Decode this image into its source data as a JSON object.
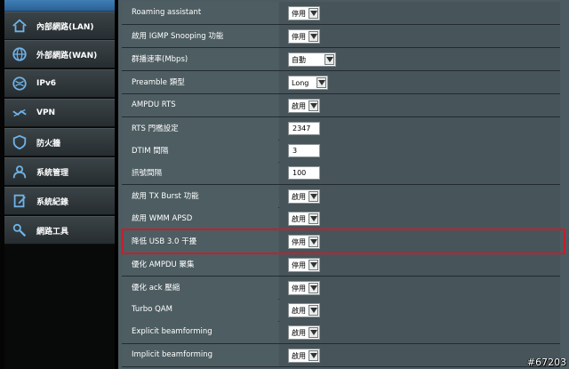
{
  "sidebar": {
    "items": [
      {
        "label": "內部網路(LAN)",
        "icon": "home-icon"
      },
      {
        "label": "外部網路(WAN)",
        "icon": "globe-icon"
      },
      {
        "label": "IPv6",
        "icon": "globe-ipv6-icon"
      },
      {
        "label": "VPN",
        "icon": "vpn-icon"
      },
      {
        "label": "防火牆",
        "icon": "shield-icon"
      },
      {
        "label": "系統管理",
        "icon": "user-icon"
      },
      {
        "label": "系統紀錄",
        "icon": "log-icon"
      },
      {
        "label": "網路工具",
        "icon": "tools-icon"
      }
    ]
  },
  "settings": {
    "rows": [
      {
        "label": "Roaming assistant",
        "control": "select",
        "value": "停用"
      },
      {
        "label": "啟用 IGMP Snooping 功能",
        "control": "select",
        "value": "停用"
      },
      {
        "label": "群播速率(Mbps)",
        "control": "select",
        "value": "自動"
      },
      {
        "label": "Preamble 類型",
        "control": "select",
        "value": "Long"
      },
      {
        "label": "AMPDU RTS",
        "control": "select",
        "value": "啟用"
      },
      {
        "label": "RTS 門檻設定",
        "control": "input",
        "value": "2347"
      },
      {
        "label": "DTIM 間隔",
        "control": "input",
        "value": "3"
      },
      {
        "label": "訊號間隔",
        "control": "input",
        "value": "100"
      },
      {
        "label": "啟用 TX Burst 功能",
        "control": "select",
        "value": "啟用"
      },
      {
        "label": "啟用 WMM APSD",
        "control": "select",
        "value": "啟用"
      },
      {
        "label": "降低 USB 3.0 干擾",
        "control": "select",
        "value": "停用"
      },
      {
        "label": "優化 AMPDU 聚集",
        "control": "select",
        "value": "停用"
      },
      {
        "label": "優化 ack 壓縮",
        "control": "select",
        "value": "停用"
      },
      {
        "label": "Turbo QAM",
        "control": "select",
        "value": "啟用"
      },
      {
        "label": "Explicit beamforming",
        "control": "select",
        "value": "啟用"
      },
      {
        "label": "Implicit beamforming",
        "control": "select",
        "value": "啟用"
      }
    ]
  },
  "highlight": {
    "row": "降低 USB 3.0 干擾",
    "color": "#c4202c"
  },
  "watermark": "#67203",
  "colors": {
    "accent_blue": "#3f7fb6",
    "panel": "#4c5b61"
  }
}
